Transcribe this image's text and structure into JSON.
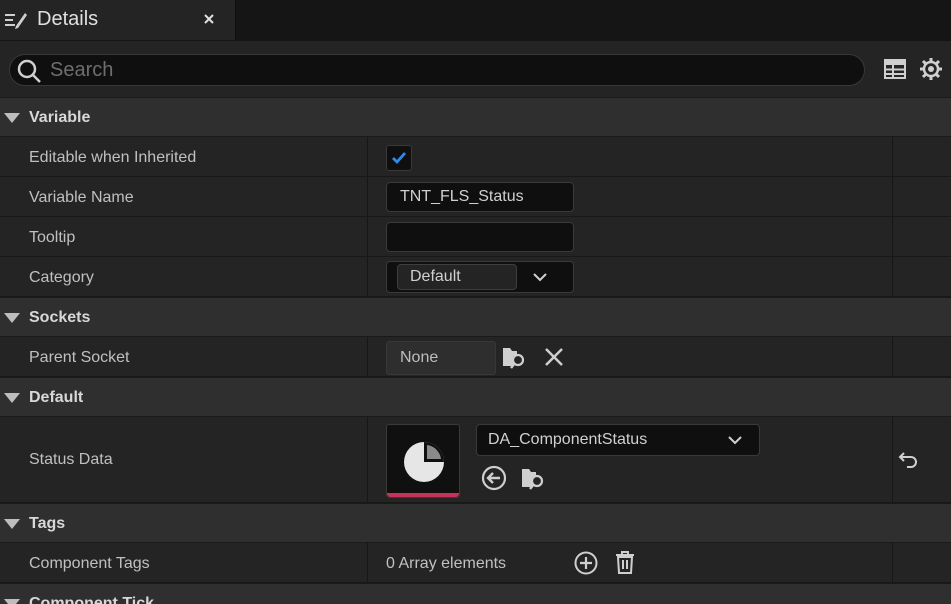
{
  "tab": {
    "title": "Details",
    "icon": "pencil-document-icon",
    "close_icon": "close-icon"
  },
  "search": {
    "placeholder": "Search",
    "value": "",
    "icon": "search-icon"
  },
  "toolbar": {
    "table_icon": "table-view-icon",
    "settings_icon": "gear-icon"
  },
  "sections": {
    "variable": {
      "title": "Variable",
      "rows": {
        "editable": {
          "label": "Editable when Inherited",
          "checked": true
        },
        "var_name": {
          "label": "Variable Name",
          "value": "TNT_FLS_Status"
        },
        "tooltip": {
          "label": "Tooltip",
          "value": ""
        },
        "category": {
          "label": "Category",
          "value": "Default"
        }
      }
    },
    "sockets": {
      "title": "Sockets",
      "rows": {
        "parent_socket": {
          "label": "Parent Socket",
          "value": "None"
        }
      }
    },
    "default": {
      "title": "Default",
      "rows": {
        "status_data": {
          "label": "Status Data",
          "asset": "DA_ComponentStatus"
        }
      }
    },
    "tags": {
      "title": "Tags",
      "rows": {
        "component_tags": {
          "label": "Component Tags",
          "value": "0 Array elements"
        }
      }
    },
    "next": {
      "title": "Component Tick"
    }
  },
  "colors": {
    "accent_check": "#2a8cf0",
    "asset_bar": "#c8325a",
    "background": "#242424"
  }
}
